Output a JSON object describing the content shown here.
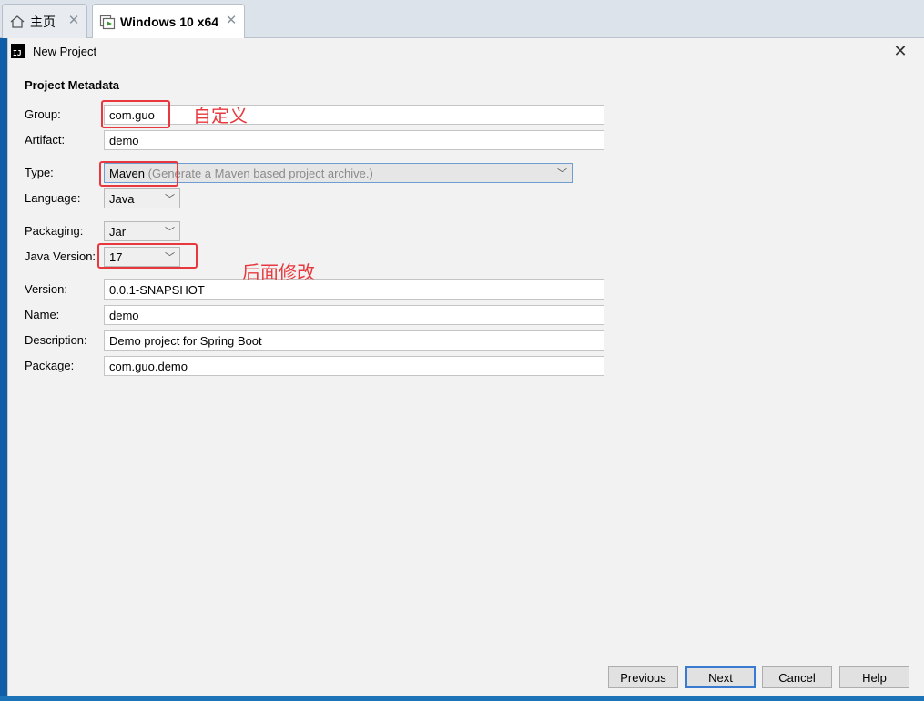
{
  "tabs": [
    {
      "label": "主页",
      "icon": "home-icon"
    },
    {
      "label": "Windows 10 x64",
      "icon": "vm-icon"
    }
  ],
  "dialog": {
    "title": "New Project",
    "section": "Project Metadata",
    "fields": {
      "group": {
        "label": "Group:",
        "value": "com.guo"
      },
      "artifact": {
        "label": "Artifact:",
        "value": "demo"
      },
      "type": {
        "label": "Type:",
        "value": "Maven",
        "hint": "(Generate a Maven based project archive.)"
      },
      "language": {
        "label": "Language:",
        "value": "Java"
      },
      "packaging": {
        "label": "Packaging:",
        "value": "Jar"
      },
      "java_version": {
        "label": "Java Version:",
        "value": "17"
      },
      "version": {
        "label": "Version:",
        "value": "0.0.1-SNAPSHOT"
      },
      "name": {
        "label": "Name:",
        "value": "demo"
      },
      "description": {
        "label": "Description:",
        "value": "Demo project for Spring Boot"
      },
      "package": {
        "label": "Package:",
        "value": "com.guo.demo"
      }
    },
    "buttons": {
      "previous": "Previous",
      "next": "Next",
      "cancel": "Cancel",
      "help": "Help"
    }
  },
  "annotations": {
    "custom": "自定义",
    "modify_later": "后面修改"
  },
  "colors": {
    "annotation_red": "#e8383d",
    "focus_blue": "#3b7ad1"
  }
}
